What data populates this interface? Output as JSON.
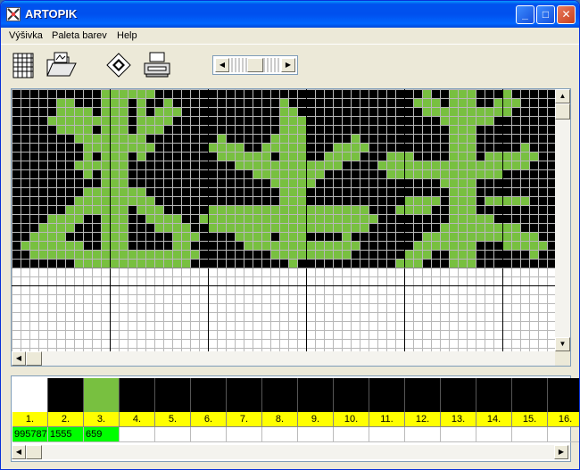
{
  "window": {
    "title": "ARTOPIK",
    "minimize_label": "_",
    "maximize_label": "□",
    "close_label": "✕"
  },
  "menu": {
    "items": [
      "Výšivka",
      "Paleta barev",
      "Help"
    ]
  },
  "toolbar": {
    "tools": [
      "new-pattern-icon",
      "open-folder-icon",
      "save-disk-icon",
      "print-icon"
    ]
  },
  "colors": {
    "accent": "#0053ee",
    "pattern_green": "#78c040",
    "pattern_black": "#000000",
    "palette_yellow": "#ffff00",
    "count_green": "#00ff00"
  },
  "palette": {
    "numbers": [
      "1.",
      "2.",
      "3.",
      "4.",
      "5.",
      "6.",
      "7.",
      "8.",
      "9.",
      "10.",
      "11.",
      "12.",
      "13.",
      "14.",
      "15.",
      "16."
    ],
    "counts": [
      "995787",
      "1555",
      "659",
      "",
      "",
      "",
      "",
      "",
      "",
      "",
      "",
      "",
      "",
      "",
      "",
      ""
    ],
    "swatch_colors": [
      "#ffffff",
      "#000000",
      "#78c040",
      "#000000",
      "#000000",
      "#000000",
      "#000000",
      "#000000",
      "#000000",
      "#000000",
      "#000000",
      "#000000",
      "#000000",
      "#000000",
      "#000000",
      "#000000"
    ]
  },
  "scroll": {
    "up": "▲",
    "down": "▼",
    "left": "◀",
    "right": "▶"
  }
}
